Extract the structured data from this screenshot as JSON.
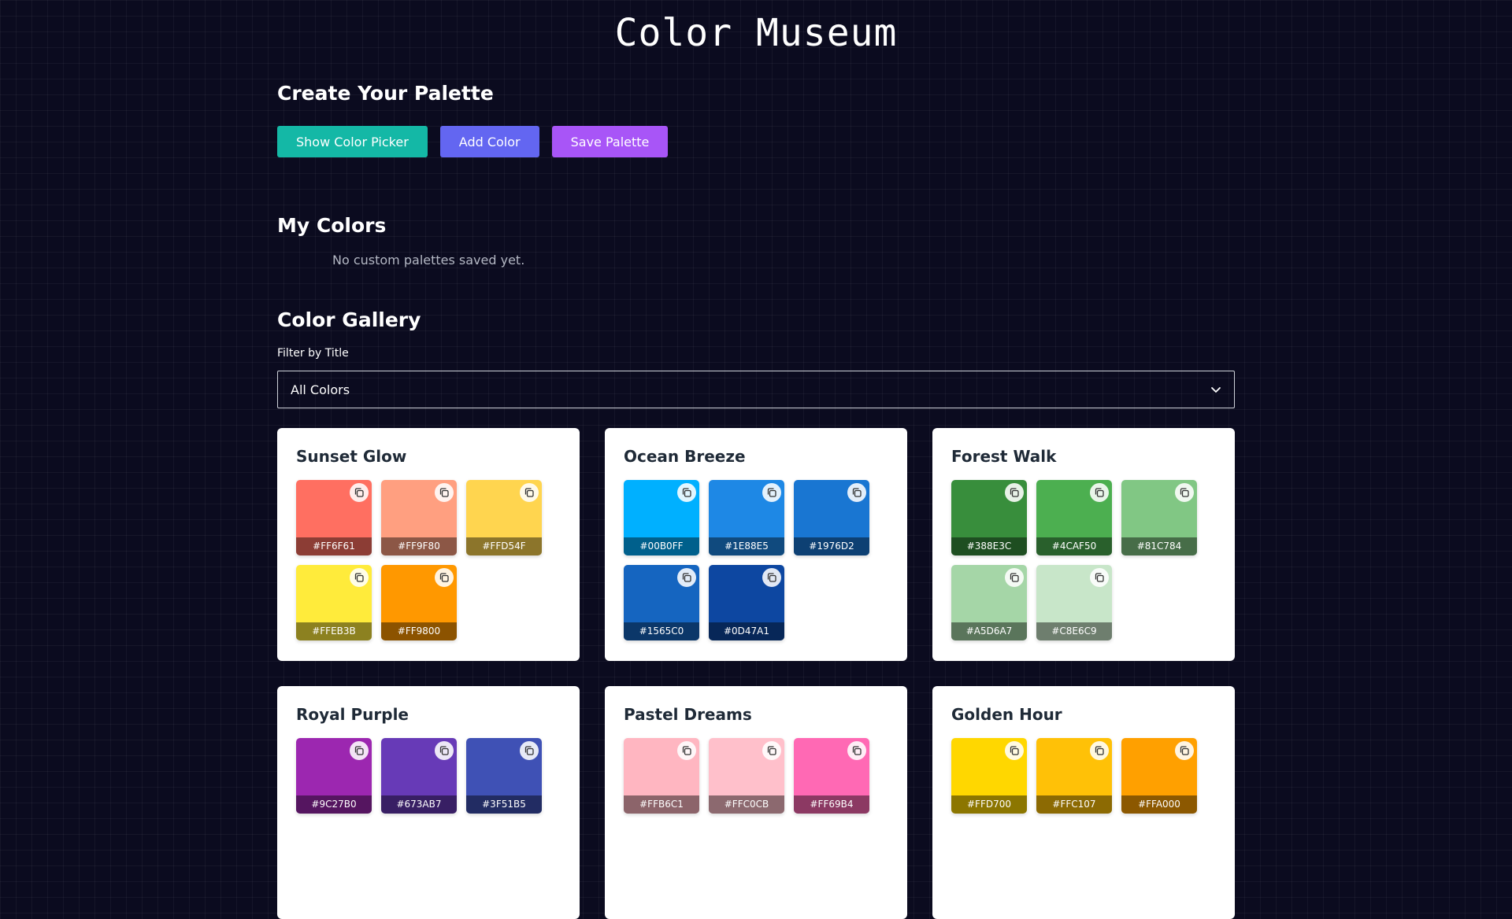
{
  "app_title": "Color Museum",
  "create": {
    "heading": "Create Your Palette",
    "buttons": {
      "show_picker": "Show Color Picker",
      "add_color": "Add Color",
      "save_palette": "Save Palette"
    }
  },
  "my_colors": {
    "heading": "My Colors",
    "empty_message": "No custom palettes saved yet."
  },
  "gallery": {
    "heading": "Color Gallery",
    "filter_label": "Filter by Title",
    "filter_value": "All Colors",
    "palettes": [
      {
        "title": "Sunset Glow",
        "colors": [
          "#FF6F61",
          "#FF9F80",
          "#FFD54F",
          "#FFEB3B",
          "#FF9800"
        ]
      },
      {
        "title": "Ocean Breeze",
        "colors": [
          "#00B0FF",
          "#1E88E5",
          "#1976D2",
          "#1565C0",
          "#0D47A1"
        ]
      },
      {
        "title": "Forest Walk",
        "colors": [
          "#388E3C",
          "#4CAF50",
          "#81C784",
          "#A5D6A7",
          "#C8E6C9"
        ]
      },
      {
        "title": "Royal Purple",
        "colors": [
          "#9C27B0",
          "#673AB7",
          "#3F51B5"
        ]
      },
      {
        "title": "Pastel Dreams",
        "colors": [
          "#FFB6C1",
          "#FFC0CB",
          "#FF69B4"
        ]
      },
      {
        "title": "Golden Hour",
        "colors": [
          "#FFD700",
          "#FFC107",
          "#FFA000"
        ]
      }
    ]
  },
  "icons": {
    "copy": "copy-icon",
    "dropdown": "chevron-down-icon"
  }
}
